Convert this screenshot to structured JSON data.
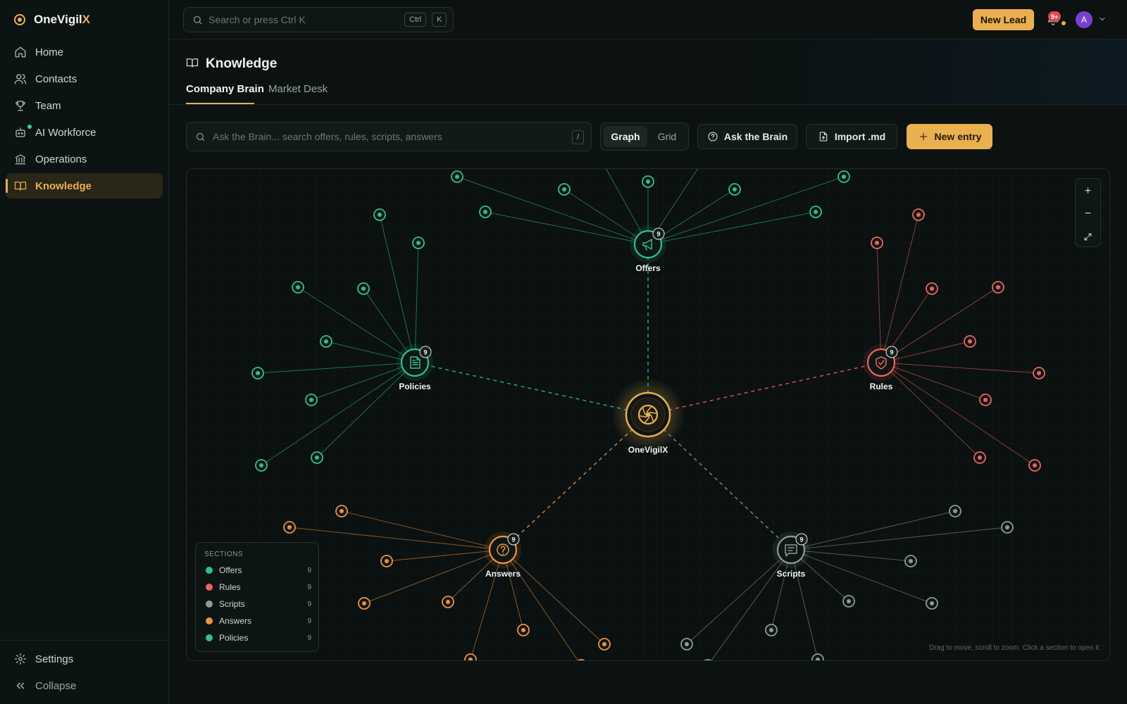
{
  "brand": {
    "name_main": "OneVigil",
    "name_accent": "X"
  },
  "sidebar": {
    "items": [
      {
        "label": "Home"
      },
      {
        "label": "Contacts"
      },
      {
        "label": "Team"
      },
      {
        "label": "AI Workforce"
      },
      {
        "label": "Operations"
      },
      {
        "label": "Knowledge"
      }
    ],
    "settings_label": "Settings",
    "collapse_label": "Collapse"
  },
  "topbar": {
    "search_placeholder": "Search or press Ctrl K",
    "kbd_ctrl": "Ctrl",
    "kbd_k": "K",
    "new_lead_label": "New Lead",
    "notification_badge": "9+",
    "avatar_initial": "A"
  },
  "page": {
    "title": "Knowledge",
    "tabs": [
      {
        "label": "Company Brain"
      },
      {
        "label": "Market Desk"
      }
    ]
  },
  "toolbar": {
    "search_placeholder": "Ask the Brain... search offers, rules, scripts, answers",
    "search_shortcut": "/",
    "view_graph": "Graph",
    "view_grid": "Grid",
    "ask_label": "Ask the Brain",
    "import_label": "Import .md",
    "new_entry_label": "New entry"
  },
  "graph": {
    "center_label": "OneVigilX",
    "hint": "Drag to move, scroll to zoom. Click a section to open it.",
    "zoom_in": "+",
    "zoom_out": "−",
    "sections": [
      {
        "name": "Offers",
        "count": "9",
        "color": "#2fbf8f"
      },
      {
        "name": "Rules",
        "count": "9",
        "color": "#f0625b"
      },
      {
        "name": "Scripts",
        "count": "9",
        "color": "#8f9a97"
      },
      {
        "name": "Answers",
        "count": "9",
        "color": "#f2923a"
      },
      {
        "name": "Policies",
        "count": "9",
        "color": "#2fbf8f"
      }
    ]
  },
  "legend": {
    "title": "SECTIONS",
    "rows": [
      {
        "name": "Offers",
        "count": "9",
        "color": "#2fbf8f"
      },
      {
        "name": "Rules",
        "count": "9",
        "color": "#f0625b"
      },
      {
        "name": "Scripts",
        "count": "9",
        "color": "#8f9a97"
      },
      {
        "name": "Answers",
        "count": "9",
        "color": "#f2923a"
      },
      {
        "name": "Policies",
        "count": "9",
        "color": "#2fbf8f"
      }
    ]
  }
}
